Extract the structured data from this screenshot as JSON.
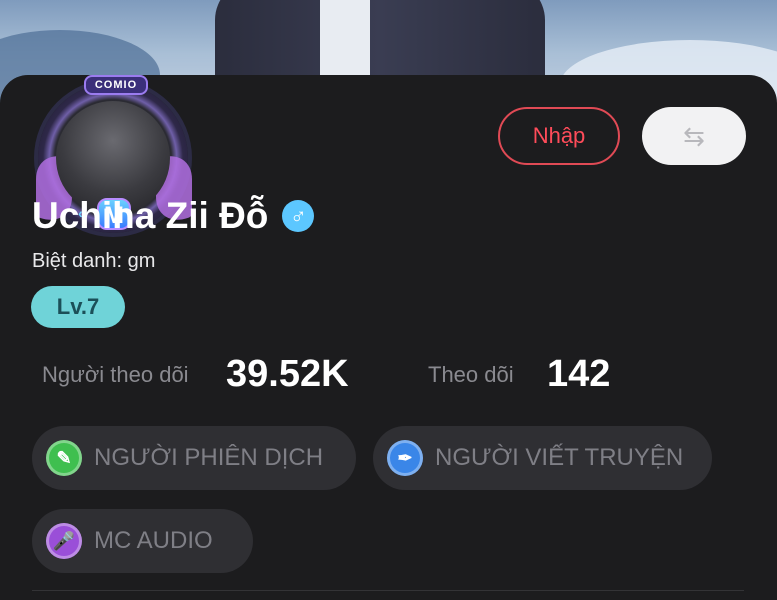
{
  "profile": {
    "avatar_badge_text": "COMIO",
    "avatar_emblem_letter": "M",
    "name": "Uchiha Zii Đỗ",
    "gender_symbol": "♂",
    "nickname": "Biệt danh: gm",
    "level": "Lv.7"
  },
  "actions": {
    "import_label": "Nhập",
    "swap_icon": "⇆"
  },
  "stats": {
    "followers_label": "Người theo dõi",
    "followers_value": "39.52K",
    "following_label": "Theo dõi",
    "following_value": "142"
  },
  "tags": [
    {
      "label": "NGƯỜI PHIÊN DỊCH",
      "icon": "quill-icon",
      "color": "#3fbf4f"
    },
    {
      "label": "NGƯỜI VIẾT TRUYỆN",
      "icon": "pen-nib-icon",
      "color": "#3a86e8"
    },
    {
      "label": "MC AUDIO",
      "icon": "microphone-icon",
      "color": "#9a4fd8"
    }
  ],
  "colors": {
    "accent_red": "#e04a55",
    "level_teal": "#6fd3d8",
    "gender_blue": "#5cc7ff",
    "card_bg": "#1c1c1e"
  }
}
